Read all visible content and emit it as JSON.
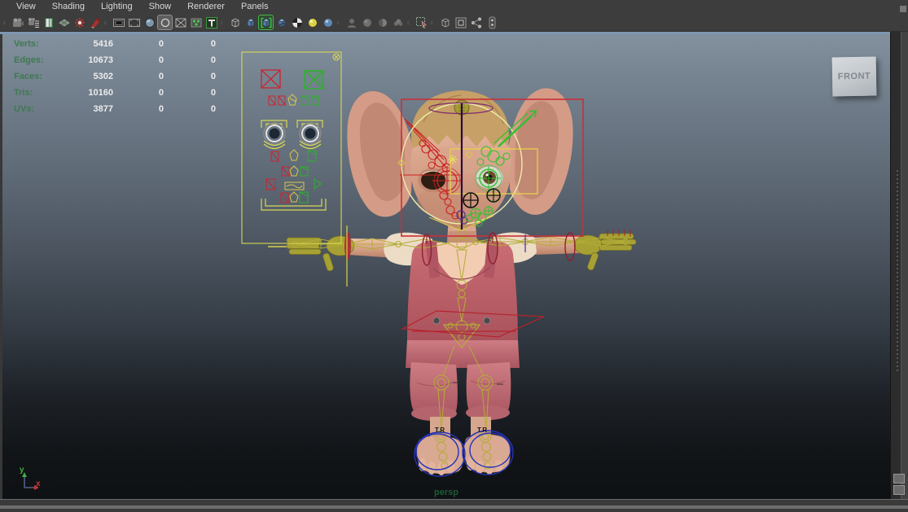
{
  "menu": {
    "items": [
      "View",
      "Shading",
      "Lighting",
      "Show",
      "Renderer",
      "Panels"
    ]
  },
  "toolbar": {
    "icons": [
      "separator",
      "select-camera-icon",
      "camera-attributes-icon",
      "bookmarks-icon",
      "image-plane-icon",
      "light-icon",
      "paint-effects-icon",
      "separator",
      "film-gate-icon",
      "resolution-gate-icon",
      "gate-mask-icon",
      "field-chart-icon",
      "safe-action-icon",
      "safe-title-icon",
      "text-tool-icon",
      "separator",
      "wireframe-icon",
      "shaded-icon",
      "wireframe-on-shaded-icon",
      "textured-icon",
      "use-all-lights-icon",
      "default-lighting-icon",
      "shadows-icon",
      "separator",
      "isolate-head-icon",
      "isolate-sphere-icon",
      "isolate-half-icon",
      "isolate-cloud-icon",
      "separator",
      "select-object-icon",
      "separator",
      "plugin-cube-icon",
      "frame-icon",
      "connections-icon",
      "end-clamp-icon"
    ],
    "active_icon": "wireframe-on-shaded-icon",
    "pressed_icon": "field-chart-icon"
  },
  "hud": {
    "rows": [
      {
        "label": "Verts:",
        "v1": "5416",
        "v2": "0",
        "v3": "0"
      },
      {
        "label": "Edges:",
        "v1": "10673",
        "v2": "0",
        "v3": "0"
      },
      {
        "label": "Faces:",
        "v1": "5302",
        "v2": "0",
        "v3": "0"
      },
      {
        "label": "Tris:",
        "v1": "10160",
        "v2": "0",
        "v3": "0"
      },
      {
        "label": "UVs:",
        "v1": "3877",
        "v2": "0",
        "v3": "0"
      }
    ]
  },
  "viewport": {
    "camera_label": "persp",
    "image_plane_label": "FRONT",
    "axis": {
      "x": "x",
      "y": "y"
    },
    "left_foot_tag": "T.R",
    "right_foot_tag": "T.R"
  },
  "colors": {
    "hud_green": "#3e7a50",
    "rig_red": "#c8303a",
    "rig_green": "#2ec22e",
    "rig_yellow": "#e7d14b",
    "pale_yellow": "#ededaa",
    "skeleton_olive": "#b3ac35",
    "control_blue": "#2633b8",
    "rig_purple": "#7c2a6e",
    "overalls_pink": "#c96d74",
    "skin": "#dca692",
    "viewport_top": "#83909e",
    "viewport_bottom": "#0e1114",
    "active_border_blue": "#7d95b0"
  }
}
